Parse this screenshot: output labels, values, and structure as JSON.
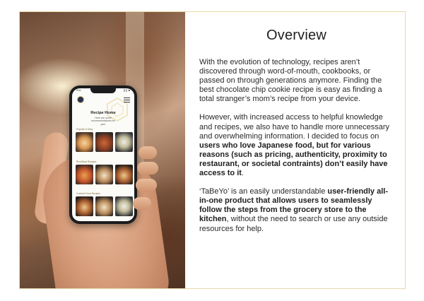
{
  "slide": {
    "heading": "Overview",
    "paragraphs": [
      {
        "segments": [
          {
            "text": "With the evolution of technology, recipes aren’t discovered through word-of-mouth, cookbooks, or passed on through generations anymore. Finding the best chocolate chip cookie recipe is easy as finding a total stranger’s mom’s recipe from your device.",
            "bold": false
          }
        ]
      },
      {
        "segments": [
          {
            "text": "However, with increased access to helpful knowledge and recipes, we also have to handle more unnecessary and overwhelming information. I decided to focus on ",
            "bold": false
          },
          {
            "text": "users who love Japanese food, but for various reasons (such as pricing, authenticity, proximity to restaurant, or societal contraints) don’t easily have access to it",
            "bold": true
          },
          {
            "text": ".",
            "bold": false
          }
        ]
      },
      {
        "segments": [
          {
            "text": "‘TaBeYo’ is an easily understandable ",
            "bold": false
          },
          {
            "text": "user-friendly all-in-one product that allows users to seamlessly follow the steps from the grocery store to the kitchen",
            "bold": true
          },
          {
            "text": ", without the need to search or use any outside resources for help.",
            "bold": false
          }
        ]
      }
    ]
  },
  "phone_app": {
    "status_time": "9:41",
    "status_icons": "▎▎■",
    "title": "Recipe Home",
    "subtitle": "Here are some recommendations for you!",
    "sections": [
      "Popular & Easy",
      "Rice/Bowl Recipes",
      "Comfort Food Recipes"
    ]
  },
  "icons": {
    "logo": "app-logo-icon",
    "menu": "hamburger-menu-icon"
  },
  "colors": {
    "border": "#e7d9a8",
    "accent_gold": "#c9b16a",
    "text": "#2a2a2a",
    "logo_navy": "#25314f"
  }
}
